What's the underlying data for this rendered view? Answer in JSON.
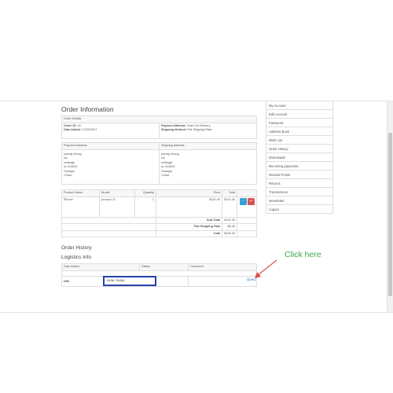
{
  "order_info_title": "Order Information",
  "order_details": {
    "header": "Order Details",
    "order_id_label": "Order ID:",
    "order_id": "40",
    "date_added_label": "Date Added:",
    "date_added": "27/09/2017",
    "payment_method_label": "Payment Method:",
    "payment_method": "Cash On Delivery",
    "shipping_method_label": "Shipping Method:",
    "shipping_method": "Flat Shipping Rate"
  },
  "addresses": {
    "payment_header": "Payment Address",
    "shipping_header": "Shipping Address",
    "payment_lines": [
      "yulong zhong",
      "zls",
      "szfdrsgh",
      "sc 414000",
      "Guangxi",
      "China"
    ],
    "shipping_lines": [
      "yulong zhong",
      "zls",
      "szfdrsgh",
      "sc 414000",
      "Guangxi",
      "China"
    ]
  },
  "products": {
    "headers": [
      "Product Name",
      "Model",
      "Quantity",
      "Price",
      "Total"
    ],
    "rows": [
      {
        "name": "iPhone",
        "model": "product 11",
        "quantity": "1",
        "price": "$101.00",
        "total": "$101.00"
      }
    ],
    "totals": [
      {
        "label": "Sub-Total",
        "value": "$101.00"
      },
      {
        "label": "Flat Shipping Rate",
        "value": "$5.00"
      },
      {
        "label": "Total",
        "value": "$106.00"
      }
    ]
  },
  "order_history_title": "Order History",
  "logistics_title": "Logistics Info",
  "logistics": {
    "headers": [
      "Date Added",
      "Status",
      "Comment"
    ],
    "carrier": "DHL",
    "tracking_number": "NUM: 33456",
    "query_label": "Query"
  },
  "callout_text": "Click here",
  "sidebar": [
    "My Account",
    "Edit Account",
    "Password",
    "Address Book",
    "Wish List",
    "Order History",
    "Downloads",
    "Recurring payments",
    "Reward Points",
    "Returns",
    "Transactions",
    "Newsletter",
    "Logout"
  ],
  "colors": {
    "highlight_border": "#2842a8",
    "callout": "#3aa64a",
    "arrow": "#d9534f",
    "link": "#2a7cc7",
    "reorder_button": "#2e9fd8",
    "return_button": "#d9534f"
  },
  "icons": {
    "reorder": "shopping-cart-icon",
    "return": "reply-icon"
  }
}
